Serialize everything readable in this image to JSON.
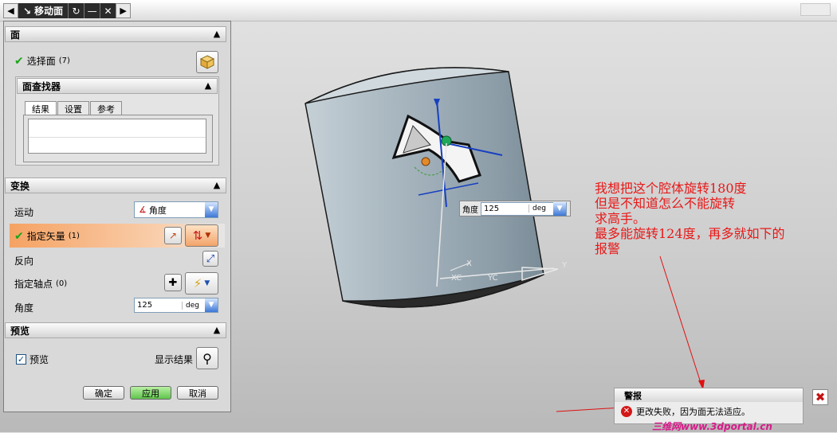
{
  "dialog": {
    "title": "移动面",
    "face_section": {
      "header": "面",
      "select_face_label": "选择面",
      "select_face_count": "(7)",
      "finder": {
        "header": "面查找器",
        "tabs": [
          "结果",
          "设置",
          "参考"
        ],
        "selected_tab": "结果"
      }
    },
    "transform_section": {
      "header": "变换",
      "motion_label": "运动",
      "motion_value": "角度",
      "vector_label": "指定矢量",
      "vector_count": "(1)",
      "reverse_label": "反向",
      "pivot_label": "指定轴点",
      "pivot_count": "(0)",
      "angle_label": "角度",
      "angle_value": "125",
      "angle_unit": "deg"
    },
    "preview_section": {
      "header": "预览",
      "preview_checkbox_label": "预览",
      "preview_checked": true,
      "show_result_label": "显示结果"
    },
    "buttons": {
      "ok": "确定",
      "apply": "应用",
      "cancel": "取消"
    }
  },
  "viewport": {
    "float_angle_label": "角度",
    "float_angle_value": "125",
    "float_angle_unit": "deg",
    "axis_labels": {
      "y": "Y",
      "yc": "YC",
      "xc": "XC",
      "x": "X"
    }
  },
  "annotation": {
    "text": "我想把这个腔体旋转180度\n但是不知道怎么不能旋转\n求高手。\n最多能旋转124度，再多就如下的\n报警",
    "color": "#e81818"
  },
  "alert": {
    "title": "警报",
    "message": "更改失败，因为面无法适应。"
  },
  "watermark": "三维网www.3dportal.cn",
  "colors": {
    "accent_orange": "#f5a263",
    "check_green": "#1ca51c",
    "apply_green": "#5fc34c",
    "error_red": "#d41717"
  }
}
